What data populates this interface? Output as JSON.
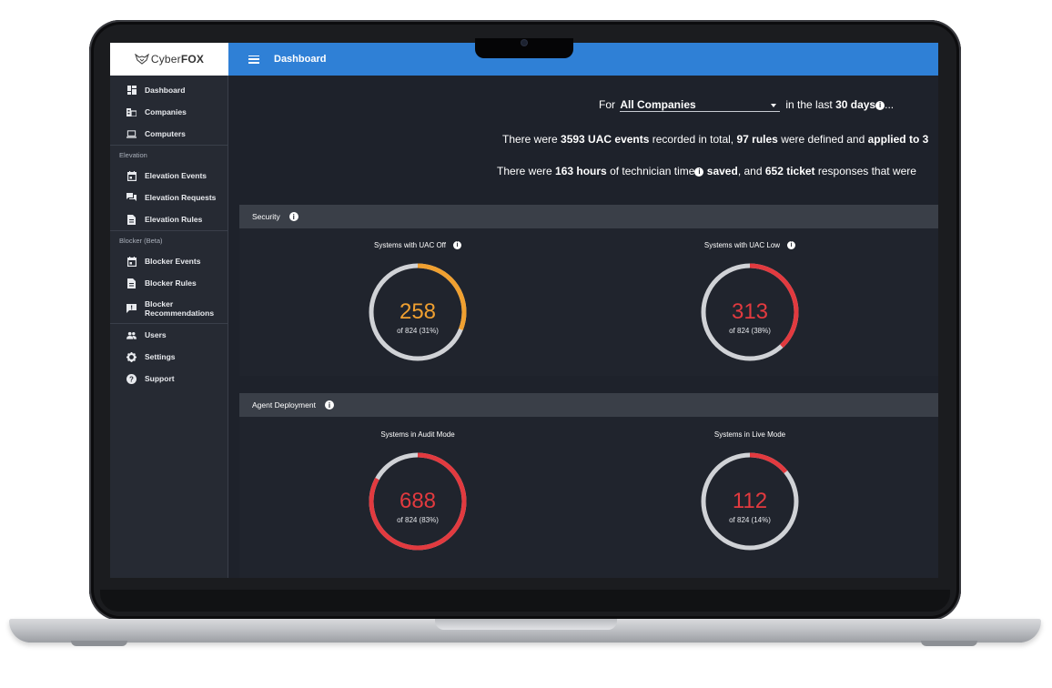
{
  "app": {
    "brand_prefix": "Cyber",
    "brand_suffix": "FOX",
    "page_title": "Dashboard"
  },
  "sidebar": {
    "items_top": [
      {
        "label": "Dashboard",
        "icon": "dashboard-icon"
      },
      {
        "label": "Companies",
        "icon": "building-icon"
      },
      {
        "label": "Computers",
        "icon": "laptop-icon"
      }
    ],
    "elevation_group": "Elevation",
    "elevation_items": [
      {
        "label": "Elevation Events",
        "icon": "calendar-icon"
      },
      {
        "label": "Elevation Requests",
        "icon": "chat-icon"
      },
      {
        "label": "Elevation Rules",
        "icon": "document-icon"
      }
    ],
    "blocker_group": "Blocker (Beta)",
    "blocker_items": [
      {
        "label": "Blocker Events",
        "icon": "calendar-icon"
      },
      {
        "label": "Blocker Rules",
        "icon": "document-icon"
      },
      {
        "label_line1": "Blocker",
        "label_line2": "Recommendations",
        "icon": "alert-icon"
      }
    ],
    "items_bottom": [
      {
        "label": "Users",
        "icon": "users-icon"
      },
      {
        "label": "Settings",
        "icon": "gear-icon"
      },
      {
        "label": "Support",
        "icon": "help-icon"
      }
    ]
  },
  "summary": {
    "filter_prefix": "For",
    "company_value": "All Companies",
    "filter_middle": "in the last",
    "days": "30 days",
    "ellipsis": "...",
    "line2_a": "There were ",
    "uac_events": "3593 UAC events",
    "line2_b": " recorded in total, ",
    "rules": "97 rules",
    "line2_c": " were defined and ",
    "applied": "applied to 3",
    "line3_a": "There were ",
    "hours": "163 hours",
    "line3_b": " of technician time",
    "saved": " saved",
    "line3_c": ", and ",
    "tickets": "652 ticket",
    "line3_d": " responses that were"
  },
  "sections": {
    "security": "Security",
    "agent": "Agent Deployment"
  },
  "gauges": [
    {
      "title": "Systems with UAC Off",
      "value": "258",
      "sub": "of 824 (31%)",
      "fraction": 0.31,
      "color": "#f0a030",
      "info": true
    },
    {
      "title": "Systems with UAC Low",
      "value": "313",
      "sub": "of 824 (38%)",
      "fraction": 0.38,
      "color": "#e23a3f",
      "info": true
    },
    {
      "title": "Systems in Audit Mode",
      "value": "688",
      "sub": "of 824 (83%)",
      "fraction": 0.83,
      "color": "#e23a3f",
      "info": false
    },
    {
      "title": "Systems in Live Mode",
      "value": "112",
      "sub": "of 824 (14%)",
      "fraction": 0.14,
      "color": "#e23a3f",
      "info": false
    }
  ],
  "colors": {
    "topbar": "#2f80d6",
    "sidebar": "#262a33",
    "main": "#1e222b",
    "track": "#d0d2d6"
  }
}
